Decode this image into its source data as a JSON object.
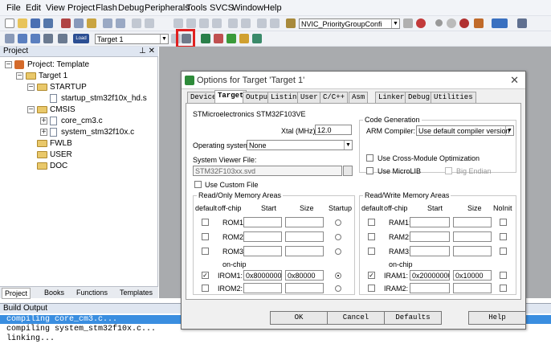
{
  "menu": [
    "File",
    "Edit",
    "View",
    "Project",
    "Flash",
    "Debug",
    "Peripherals",
    "Tools",
    "SVCS",
    "Window",
    "Help"
  ],
  "toolbar": {
    "search_combo": "NVIC_PriorityGroupConfi",
    "target_combo": "Target 1",
    "load_label": "Load"
  },
  "project": {
    "header": "Project",
    "root": "Project: Template",
    "target": "Target 1",
    "groups": [
      {
        "name": "STARTUP",
        "files": [
          "startup_stm32f10x_hd.s"
        ]
      },
      {
        "name": "CMSIS",
        "files": [
          "core_cm3.c",
          "system_stm32f10x.c"
        ]
      },
      {
        "name": "FWLB",
        "files": []
      },
      {
        "name": "USER",
        "files": []
      },
      {
        "name": "DOC",
        "files": []
      }
    ],
    "tabs": [
      "Project",
      "Books",
      "Functions",
      "Templates"
    ]
  },
  "build": {
    "header": "Build Output",
    "lines": [
      "compiling core_cm3.c...",
      "compiling system_stm32f10x.c...",
      "linking..."
    ]
  },
  "dialog": {
    "title": "Options for Target 'Target 1'",
    "close": "✕",
    "tabs": [
      "Device",
      "Target",
      "Output",
      "Listing",
      "User",
      "C/C++",
      "Asm",
      "Linker",
      "Debug",
      "Utilities"
    ],
    "device": "STMicroelectronics STM32F103VE",
    "xtal_label": "Xtal (MHz):",
    "xtal_value": "12.0",
    "os_label": "Operating system:",
    "os_value": "None",
    "svf_label": "System Viewer File:",
    "svf_value": "STM32F103xx.svd",
    "custom_file": "Use Custom File",
    "codegen": {
      "title": "Code Generation",
      "compiler_label": "ARM Compiler:",
      "compiler_value": "Use default compiler version",
      "cross": "Use Cross-Module Optimization",
      "microlib": "Use MicroLIB",
      "endian": "Big Endian"
    },
    "rom": {
      "title": "Read/Only Memory Areas",
      "cols": [
        "default",
        "off-chip",
        "Start",
        "Size",
        "Startup"
      ],
      "rows": [
        "ROM1:",
        "ROM2:",
        "ROM3:"
      ],
      "onchip": "on-chip",
      "irom1": {
        "name": "IROM1:",
        "start": "0x8000000",
        "size": "0x80000"
      },
      "irom2": "IROM2:"
    },
    "ram": {
      "title": "Read/Write Memory Areas",
      "cols": [
        "default",
        "off-chip",
        "Start",
        "Size",
        "NoInit"
      ],
      "rows": [
        "RAM1:",
        "RAM2:",
        "RAM3:"
      ],
      "onchip": "on-chip",
      "iram1": {
        "name": "IRAM1:",
        "start": "0x20000000",
        "size": "0x10000"
      },
      "iram2": "IRAM2:"
    },
    "buttons": {
      "ok": "OK",
      "cancel": "Cancel",
      "defaults": "Defaults",
      "help": "Help"
    }
  }
}
